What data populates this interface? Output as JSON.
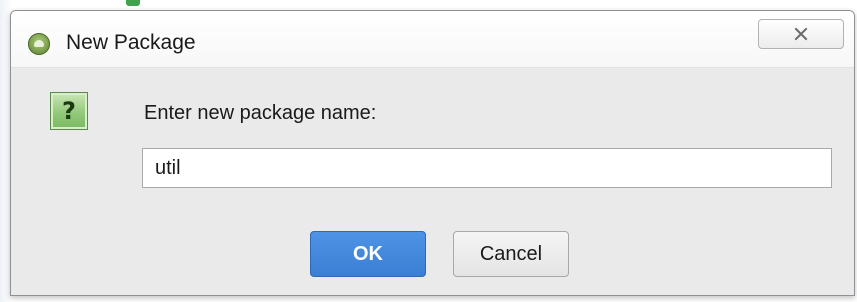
{
  "dialog": {
    "title": "New Package",
    "app_icon": "android-studio-icon",
    "close_icon": "close-icon"
  },
  "prompt": {
    "icon": "question-icon",
    "icon_glyph": "?",
    "label": "Enter new package name:"
  },
  "input": {
    "value": "util",
    "placeholder": ""
  },
  "buttons": {
    "ok_label": "OK",
    "cancel_label": "Cancel"
  },
  "colors": {
    "ok_button": "#3b7fd4",
    "question_icon": "#8fc776",
    "dialog_body": "#eaeaea"
  }
}
